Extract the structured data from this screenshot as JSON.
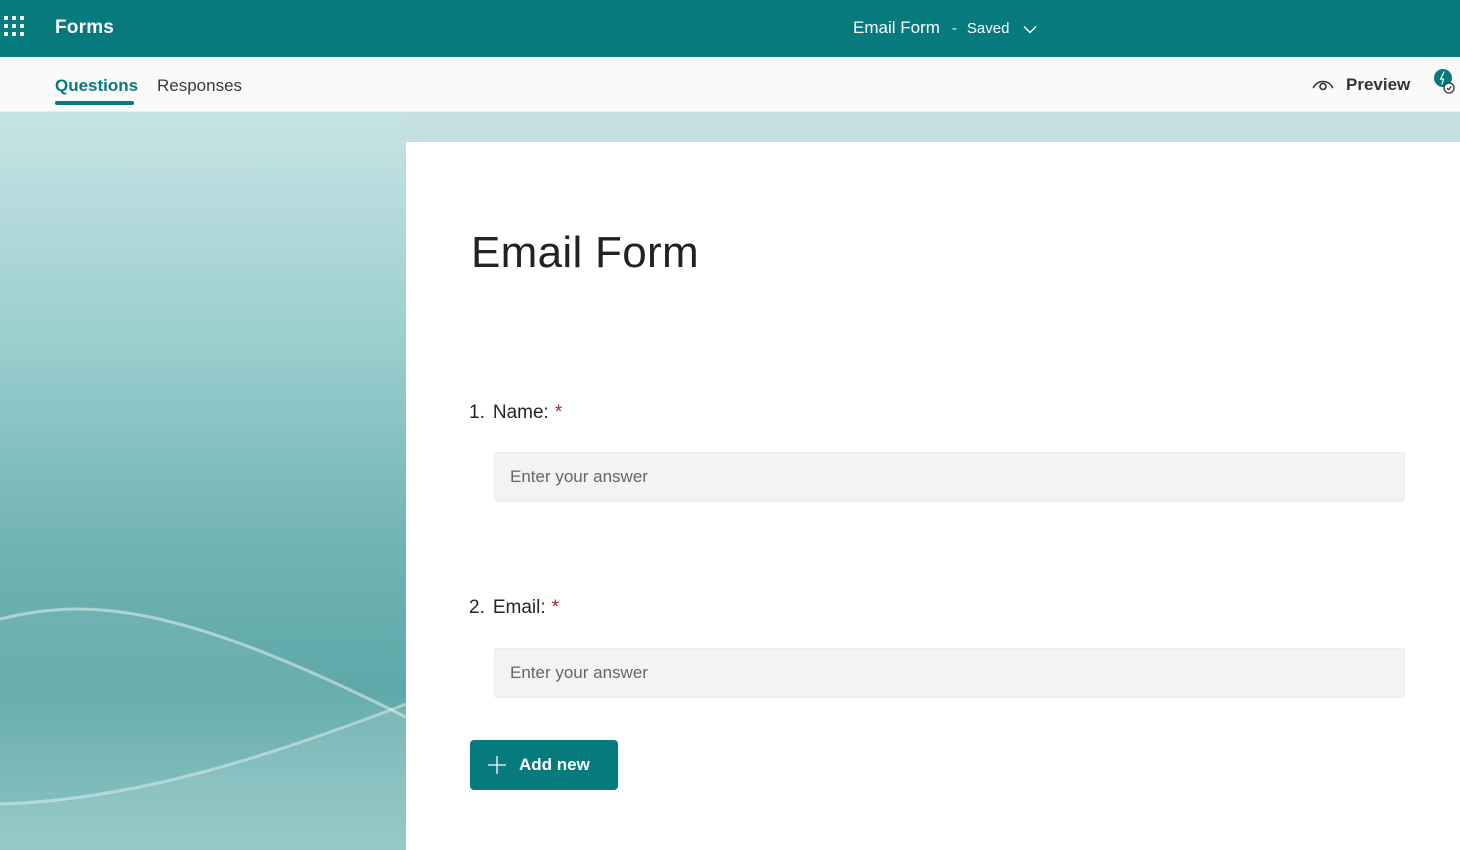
{
  "colors": {
    "brand": "#077a7e",
    "required_asterisk": "#a4262c"
  },
  "header": {
    "app_name": "Forms",
    "doc_title": "Email Form",
    "separator": "-",
    "save_status": "Saved",
    "icons": {
      "app_launcher": "waffle-icon",
      "status_menu": "chevron-down-icon"
    }
  },
  "tabs": [
    {
      "label": "Questions",
      "active": true
    },
    {
      "label": "Responses",
      "active": false
    }
  ],
  "toolbar": {
    "preview_label": "Preview",
    "preview_icon": "eye-icon",
    "extra_icon": "lab-icon"
  },
  "form": {
    "title": "Email Form",
    "questions": [
      {
        "number": "1.",
        "label": "Name:",
        "required_mark": "*",
        "placeholder": "Enter your answer"
      },
      {
        "number": "2.",
        "label": "Email:",
        "required_mark": "*",
        "placeholder": "Enter your answer"
      }
    ],
    "add_button_label": "Add new",
    "add_button_icon": "plus-icon"
  }
}
